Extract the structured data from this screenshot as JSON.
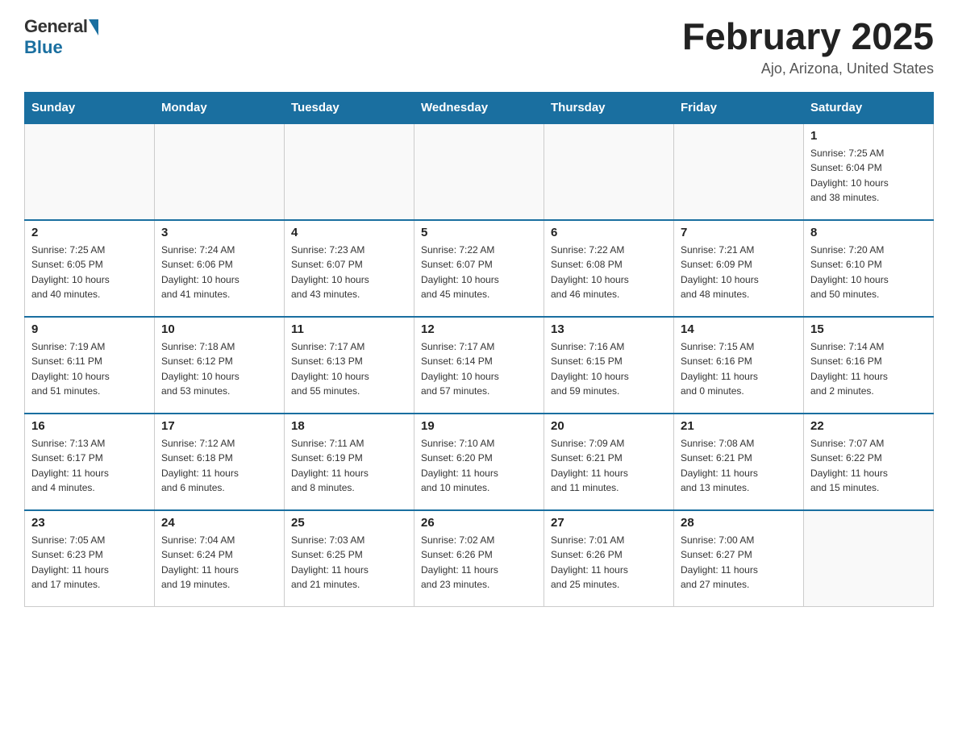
{
  "header": {
    "logo_general": "General",
    "logo_blue": "Blue",
    "title": "February 2025",
    "location": "Ajo, Arizona, United States"
  },
  "days_of_week": [
    "Sunday",
    "Monday",
    "Tuesday",
    "Wednesday",
    "Thursday",
    "Friday",
    "Saturday"
  ],
  "weeks": [
    [
      {
        "day": "",
        "info": ""
      },
      {
        "day": "",
        "info": ""
      },
      {
        "day": "",
        "info": ""
      },
      {
        "day": "",
        "info": ""
      },
      {
        "day": "",
        "info": ""
      },
      {
        "day": "",
        "info": ""
      },
      {
        "day": "1",
        "info": "Sunrise: 7:25 AM\nSunset: 6:04 PM\nDaylight: 10 hours\nand 38 minutes."
      }
    ],
    [
      {
        "day": "2",
        "info": "Sunrise: 7:25 AM\nSunset: 6:05 PM\nDaylight: 10 hours\nand 40 minutes."
      },
      {
        "day": "3",
        "info": "Sunrise: 7:24 AM\nSunset: 6:06 PM\nDaylight: 10 hours\nand 41 minutes."
      },
      {
        "day": "4",
        "info": "Sunrise: 7:23 AM\nSunset: 6:07 PM\nDaylight: 10 hours\nand 43 minutes."
      },
      {
        "day": "5",
        "info": "Sunrise: 7:22 AM\nSunset: 6:07 PM\nDaylight: 10 hours\nand 45 minutes."
      },
      {
        "day": "6",
        "info": "Sunrise: 7:22 AM\nSunset: 6:08 PM\nDaylight: 10 hours\nand 46 minutes."
      },
      {
        "day": "7",
        "info": "Sunrise: 7:21 AM\nSunset: 6:09 PM\nDaylight: 10 hours\nand 48 minutes."
      },
      {
        "day": "8",
        "info": "Sunrise: 7:20 AM\nSunset: 6:10 PM\nDaylight: 10 hours\nand 50 minutes."
      }
    ],
    [
      {
        "day": "9",
        "info": "Sunrise: 7:19 AM\nSunset: 6:11 PM\nDaylight: 10 hours\nand 51 minutes."
      },
      {
        "day": "10",
        "info": "Sunrise: 7:18 AM\nSunset: 6:12 PM\nDaylight: 10 hours\nand 53 minutes."
      },
      {
        "day": "11",
        "info": "Sunrise: 7:17 AM\nSunset: 6:13 PM\nDaylight: 10 hours\nand 55 minutes."
      },
      {
        "day": "12",
        "info": "Sunrise: 7:17 AM\nSunset: 6:14 PM\nDaylight: 10 hours\nand 57 minutes."
      },
      {
        "day": "13",
        "info": "Sunrise: 7:16 AM\nSunset: 6:15 PM\nDaylight: 10 hours\nand 59 minutes."
      },
      {
        "day": "14",
        "info": "Sunrise: 7:15 AM\nSunset: 6:16 PM\nDaylight: 11 hours\nand 0 minutes."
      },
      {
        "day": "15",
        "info": "Sunrise: 7:14 AM\nSunset: 6:16 PM\nDaylight: 11 hours\nand 2 minutes."
      }
    ],
    [
      {
        "day": "16",
        "info": "Sunrise: 7:13 AM\nSunset: 6:17 PM\nDaylight: 11 hours\nand 4 minutes."
      },
      {
        "day": "17",
        "info": "Sunrise: 7:12 AM\nSunset: 6:18 PM\nDaylight: 11 hours\nand 6 minutes."
      },
      {
        "day": "18",
        "info": "Sunrise: 7:11 AM\nSunset: 6:19 PM\nDaylight: 11 hours\nand 8 minutes."
      },
      {
        "day": "19",
        "info": "Sunrise: 7:10 AM\nSunset: 6:20 PM\nDaylight: 11 hours\nand 10 minutes."
      },
      {
        "day": "20",
        "info": "Sunrise: 7:09 AM\nSunset: 6:21 PM\nDaylight: 11 hours\nand 11 minutes."
      },
      {
        "day": "21",
        "info": "Sunrise: 7:08 AM\nSunset: 6:21 PM\nDaylight: 11 hours\nand 13 minutes."
      },
      {
        "day": "22",
        "info": "Sunrise: 7:07 AM\nSunset: 6:22 PM\nDaylight: 11 hours\nand 15 minutes."
      }
    ],
    [
      {
        "day": "23",
        "info": "Sunrise: 7:05 AM\nSunset: 6:23 PM\nDaylight: 11 hours\nand 17 minutes."
      },
      {
        "day": "24",
        "info": "Sunrise: 7:04 AM\nSunset: 6:24 PM\nDaylight: 11 hours\nand 19 minutes."
      },
      {
        "day": "25",
        "info": "Sunrise: 7:03 AM\nSunset: 6:25 PM\nDaylight: 11 hours\nand 21 minutes."
      },
      {
        "day": "26",
        "info": "Sunrise: 7:02 AM\nSunset: 6:26 PM\nDaylight: 11 hours\nand 23 minutes."
      },
      {
        "day": "27",
        "info": "Sunrise: 7:01 AM\nSunset: 6:26 PM\nDaylight: 11 hours\nand 25 minutes."
      },
      {
        "day": "28",
        "info": "Sunrise: 7:00 AM\nSunset: 6:27 PM\nDaylight: 11 hours\nand 27 minutes."
      },
      {
        "day": "",
        "info": ""
      }
    ]
  ]
}
